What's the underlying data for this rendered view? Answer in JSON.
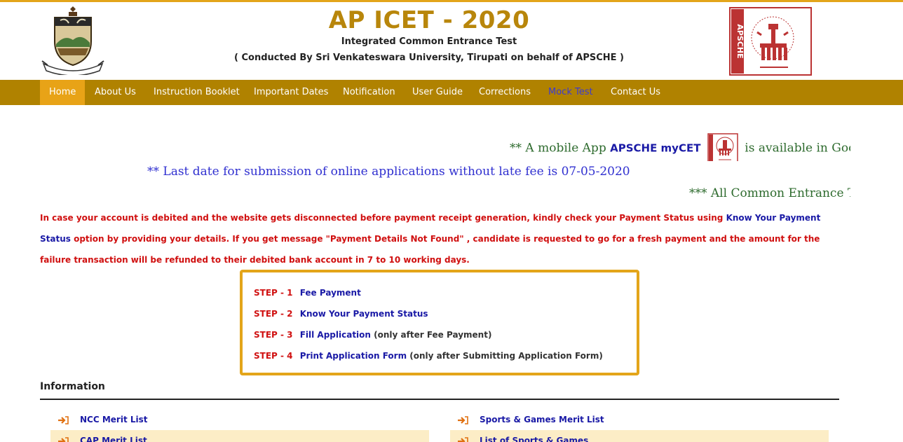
{
  "header": {
    "title": "AP ICET - 2020",
    "subtitle": "Integrated Common Entrance Test",
    "conducted": "( Conducted By Sri Venkateswara University, Tirupati on behalf of APSCHE )",
    "right_logo_text": "APSCHE"
  },
  "nav": {
    "items": [
      {
        "label": "Home"
      },
      {
        "label": "About Us"
      },
      {
        "label": "Instruction Booklet"
      },
      {
        "label": "Important Dates"
      },
      {
        "label": "Notification"
      },
      {
        "label": "User Guide"
      },
      {
        "label": "Corrections"
      },
      {
        "label": "Mock Test"
      },
      {
        "label": "Contact Us"
      }
    ],
    "active": "Home"
  },
  "marquees": {
    "app_prefix": "** A mobile App",
    "app_name": "APSCHE myCET",
    "app_suffix": "is available in Goog",
    "last_date": "** Last date for submission of online applications without late fee is 07-05-2020",
    "common_entrance": "*** All Common Entrance T"
  },
  "notice": {
    "part1": "In case your account is debited and the website gets disconnected before payment receipt generation, kindly check your Payment Status using",
    "link": "Know Your Payment Status",
    "part2": "option by providing your details. If you get message \"Payment Details Not Found\" , candidate is requested to go for a fresh payment and the amount for the failure transaction will be refunded to their debited bank account in 7 to 10 working days."
  },
  "steps": [
    {
      "label": "STEP - 1",
      "action": "Fee Payment",
      "note": ""
    },
    {
      "label": "STEP - 2",
      "action": "Know Your Payment Status",
      "note": ""
    },
    {
      "label": "STEP - 3",
      "action": "Fill Application",
      "note": "(only after Fee Payment)"
    },
    {
      "label": "STEP - 4",
      "action": "Print Application Form",
      "note": "(only after Submitting Application Form)"
    }
  ],
  "information": {
    "heading": "Information",
    "left": [
      "NCC Merit List",
      "CAP Merit List"
    ],
    "right": [
      "Sports & Games Merit List",
      "List of Sports & Games"
    ]
  },
  "colors": {
    "nav_bg": "#b08200",
    "nav_active": "#e8a317",
    "title_gold": "#b8860b",
    "accent_border": "#e3a51a",
    "notice_red": "#d01010",
    "link_blue": "#1a1aa6"
  }
}
